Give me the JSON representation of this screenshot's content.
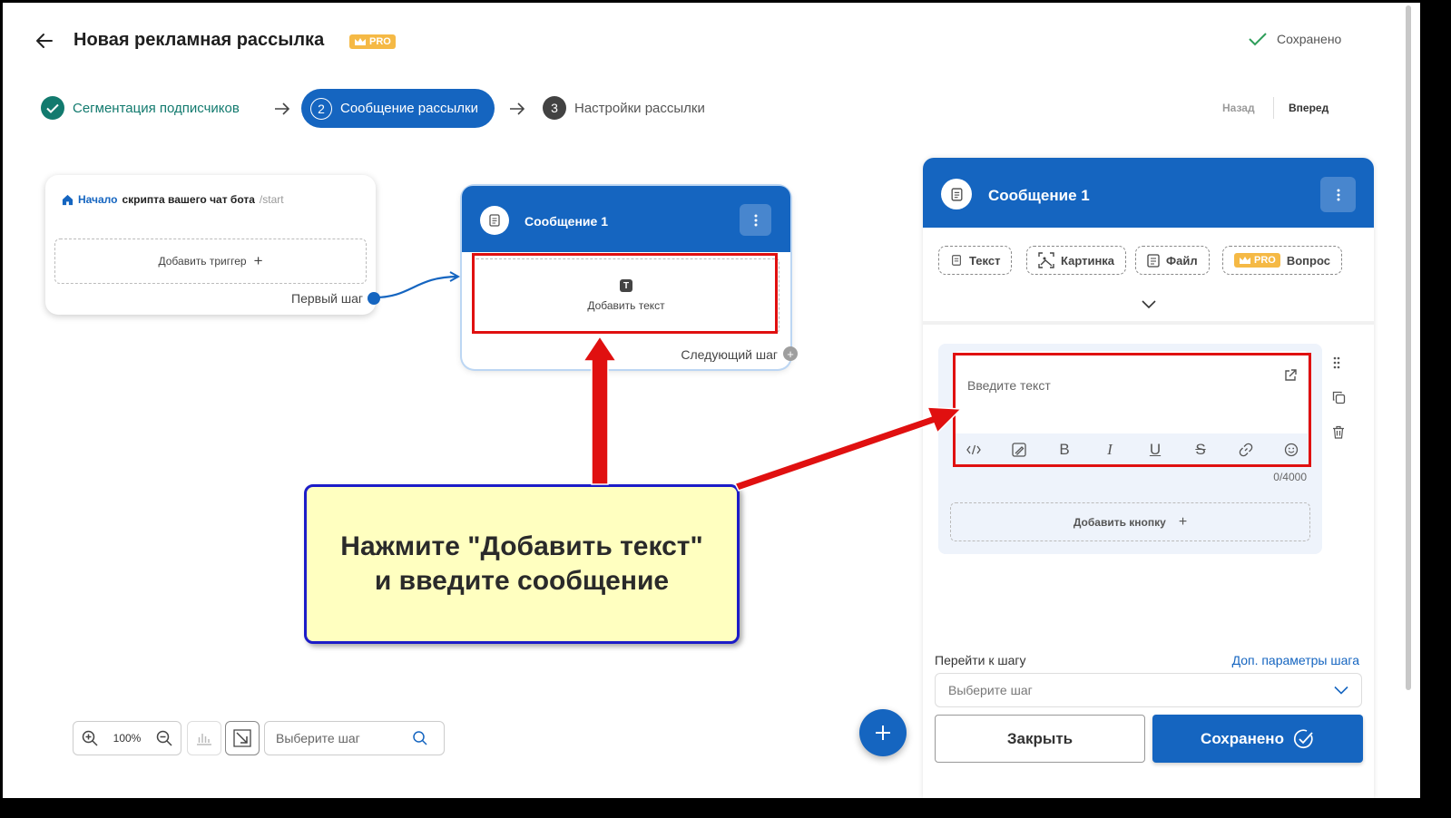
{
  "header": {
    "title": "Новая рекламная рассылка",
    "pro_badge": "PRO",
    "saved_status": "Сохранено"
  },
  "steps": [
    {
      "number": "",
      "label": "Сегментация подписчиков",
      "state": "done"
    },
    {
      "number": "2",
      "label": "Сообщение рассылки",
      "state": "active"
    },
    {
      "number": "3",
      "label": "Настройки рассылки",
      "state": "pending"
    }
  ],
  "nav": {
    "back": "Назад",
    "next": "Вперед"
  },
  "start_node": {
    "link_text": "Начало",
    "text": "скрипта вашего чат бота",
    "command": "/start",
    "add_trigger": "Добавить триггер",
    "first_step": "Первый шаг"
  },
  "message_node": {
    "title": "Сообщение 1",
    "add_text": "Добавить текст",
    "add_text_icon": "T",
    "next_step": "Следующий шаг"
  },
  "callout": {
    "line1": "Нажмите \"Добавить текст\"",
    "line2": "и введите сообщение"
  },
  "toolbar": {
    "zoom": "100%",
    "search_placeholder": "Выберите шаг"
  },
  "panel": {
    "title": "Сообщение 1",
    "chips": [
      "Текст",
      "Картинка",
      "Файл",
      "Вопрос"
    ],
    "chip_pro": "PRO",
    "editor_placeholder": "Введите текст",
    "format_bold": "B",
    "format_italic": "I",
    "format_underline": "U",
    "format_strike": "S",
    "char_count": "0/4000",
    "add_button": "Добавить кнопку",
    "goto_label": "Перейти к шагу",
    "advanced_link": "Доп. параметры шага",
    "step_select_placeholder": "Выберите шаг",
    "close_button": "Закрыть",
    "save_button": "Сохранено"
  },
  "colors": {
    "primary": "#1565c0",
    "teal": "#127a6e",
    "pro": "#f5b945",
    "annotation_red": "#e01010",
    "callout_bg": "#ffffc0",
    "callout_border": "#1c1cc8"
  }
}
